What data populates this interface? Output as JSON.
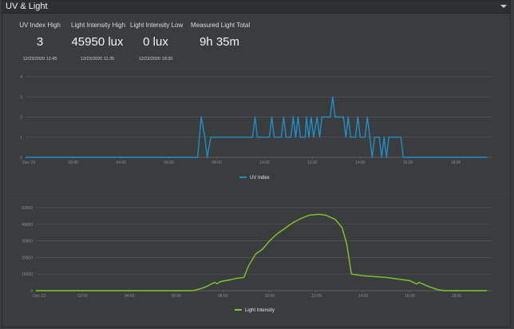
{
  "panel": {
    "title": "UV & Light",
    "menu_icon": "chevron-down-icon"
  },
  "stats": [
    {
      "label": "UV Index High",
      "value": "3",
      "time": "12/23/2020 12:45"
    },
    {
      "label": "Light Intensity High",
      "value": "45950 lux",
      "time": "12/23/2020 11:35"
    },
    {
      "label": "Light Intensity Low",
      "value": "0 lux",
      "time": "12/23/2020 18:30"
    },
    {
      "label": "Measured Light Total",
      "value": "9h 35m",
      "time": ""
    }
  ],
  "chart_data": [
    {
      "type": "line",
      "x_ticks": [
        "Dec 23",
        "02:00",
        "04:00",
        "06:00",
        "08:00",
        "10:00",
        "12:00",
        "14:00",
        "16:00",
        "18:00"
      ],
      "y_ticks": [
        "0",
        "1",
        "2",
        "3",
        "4"
      ],
      "ylim": [
        0,
        4
      ],
      "xlim": [
        0,
        19.5
      ],
      "series": [
        {
          "name": "UV Index",
          "color": "#1e90c8",
          "points": [
            [
              0,
              0
            ],
            [
              7.2,
              0
            ],
            [
              7.35,
              2
            ],
            [
              7.5,
              1
            ],
            [
              7.6,
              0
            ],
            [
              7.75,
              1
            ],
            [
              9.5,
              1
            ],
            [
              9.6,
              2
            ],
            [
              9.7,
              1
            ],
            [
              10.2,
              1
            ],
            [
              10.3,
              2
            ],
            [
              10.4,
              1
            ],
            [
              10.7,
              1
            ],
            [
              10.8,
              2
            ],
            [
              10.9,
              1
            ],
            [
              11.1,
              1
            ],
            [
              11.2,
              2
            ],
            [
              11.3,
              1
            ],
            [
              11.4,
              2
            ],
            [
              11.5,
              1
            ],
            [
              11.7,
              1
            ],
            [
              11.75,
              2
            ],
            [
              11.85,
              1
            ],
            [
              11.95,
              2
            ],
            [
              12.05,
              1
            ],
            [
              12.2,
              2
            ],
            [
              12.3,
              1
            ],
            [
              12.4,
              2
            ],
            [
              12.55,
              2
            ],
            [
              12.75,
              2
            ],
            [
              12.85,
              3
            ],
            [
              12.95,
              2
            ],
            [
              13.3,
              2
            ],
            [
              13.4,
              1
            ],
            [
              13.5,
              2
            ],
            [
              13.6,
              1
            ],
            [
              13.8,
              1
            ],
            [
              13.9,
              2
            ],
            [
              14.0,
              1
            ],
            [
              14.2,
              1
            ],
            [
              14.3,
              2
            ],
            [
              14.4,
              1
            ],
            [
              14.5,
              0
            ],
            [
              14.6,
              1
            ],
            [
              14.8,
              1
            ],
            [
              14.9,
              0
            ],
            [
              15.0,
              1
            ],
            [
              15.1,
              0
            ],
            [
              15.2,
              1
            ],
            [
              15.7,
              1
            ],
            [
              15.8,
              0
            ],
            [
              19.3,
              0
            ]
          ]
        }
      ]
    },
    {
      "type": "line",
      "x_ticks": [
        "Dec 23",
        "02:00",
        "04:00",
        "06:00",
        "08:00",
        "10:00",
        "12:00",
        "14:00",
        "16:00",
        "18:00"
      ],
      "y_ticks": [
        "0",
        "10000",
        "20000",
        "30000",
        "40000",
        "50000"
      ],
      "ylim": [
        0,
        50000
      ],
      "xlim": [
        0,
        19.5
      ],
      "series": [
        {
          "name": "Light Intensity",
          "color": "#7ccb2a",
          "points": [
            [
              0,
              0
            ],
            [
              6.7,
              0
            ],
            [
              7.0,
              1000
            ],
            [
              7.3,
              2500
            ],
            [
              7.5,
              4000
            ],
            [
              7.65,
              5000
            ],
            [
              7.75,
              4200
            ],
            [
              7.9,
              5500
            ],
            [
              8.3,
              6500
            ],
            [
              8.6,
              7500
            ],
            [
              8.9,
              8000
            ],
            [
              9.1,
              15000
            ],
            [
              9.4,
              22000
            ],
            [
              9.7,
              25000
            ],
            [
              10.0,
              30000
            ],
            [
              10.3,
              34000
            ],
            [
              10.7,
              38000
            ],
            [
              11.0,
              41000
            ],
            [
              11.35,
              43500
            ],
            [
              11.7,
              45500
            ],
            [
              12.1,
              46000
            ],
            [
              12.4,
              45500
            ],
            [
              12.8,
              43000
            ],
            [
              13.1,
              38000
            ],
            [
              13.3,
              28000
            ],
            [
              13.5,
              10000
            ],
            [
              14.0,
              9000
            ],
            [
              15.0,
              8000
            ],
            [
              16.0,
              6000
            ],
            [
              16.3,
              4000
            ],
            [
              16.4,
              5000
            ],
            [
              16.8,
              2500
            ],
            [
              17.2,
              600
            ],
            [
              17.5,
              0
            ],
            [
              19.3,
              0
            ]
          ]
        }
      ]
    }
  ]
}
